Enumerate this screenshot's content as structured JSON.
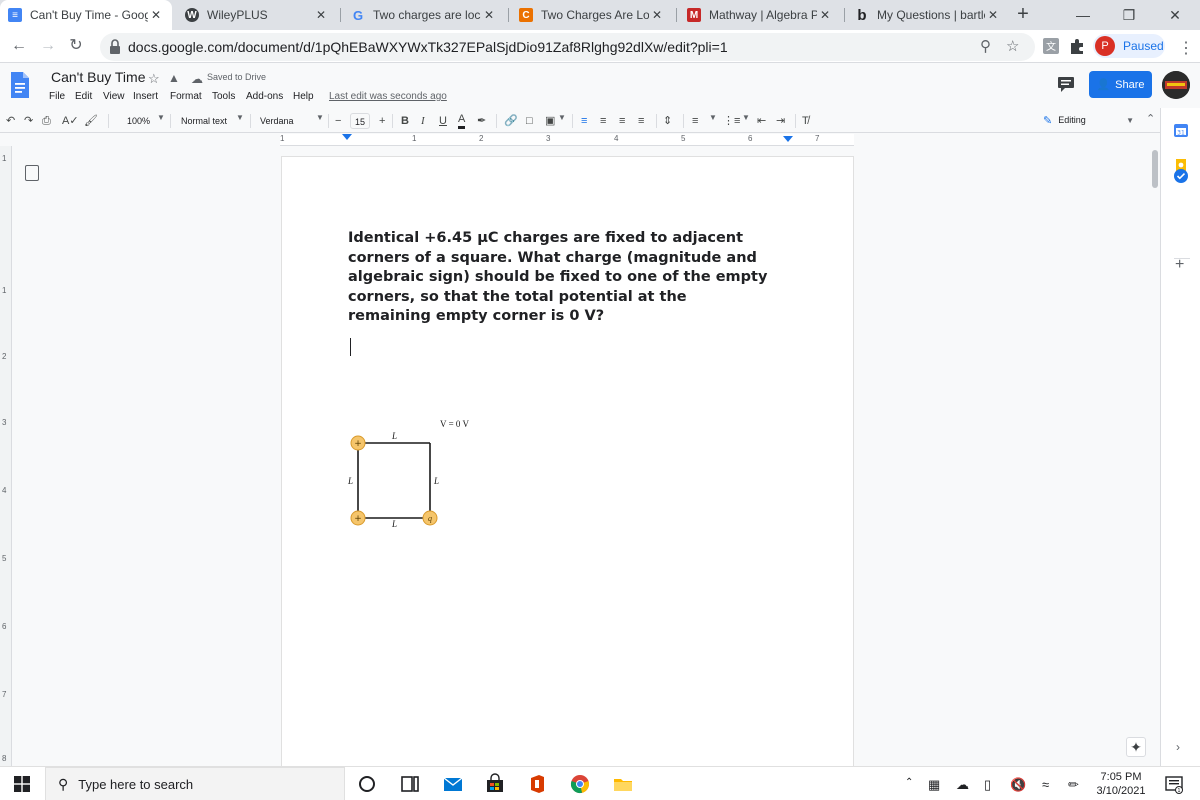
{
  "browser": {
    "tabs": [
      {
        "title": "Can't Buy Time - Googl",
        "active": true
      },
      {
        "title": "WileyPLUS",
        "active": false
      },
      {
        "title": "Two charges are locate",
        "active": false
      },
      {
        "title": "Two Charges Are Locate",
        "active": false
      },
      {
        "title": "Mathway | Algebra Prol",
        "active": false
      },
      {
        "title": "My Questions | bartleby",
        "active": false
      }
    ],
    "url": "docs.google.com/document/d/1pQhEBaWXYWxTk327EPalSjdDio91Zaf8Rlghg92dlXw/edit?pli=1",
    "profile_initial": "P",
    "profile_status": "Paused"
  },
  "docs": {
    "title": "Can't Buy Time",
    "save_status": "Saved to Drive",
    "menus": [
      "File",
      "Edit",
      "View",
      "Insert",
      "Format",
      "Tools",
      "Add-ons",
      "Help"
    ],
    "last_edit": "Last edit was seconds ago",
    "share_label": "Share",
    "toolbar": {
      "zoom": "100%",
      "style": "Normal text",
      "font": "Verdana",
      "font_size": "15",
      "mode": "Editing"
    },
    "ruler_numbers": [
      "1",
      "1",
      "2",
      "3",
      "4",
      "5",
      "6",
      "7"
    ],
    "vruler_numbers": [
      "1",
      "1",
      "2",
      "3",
      "4",
      "5",
      "6",
      "7",
      "8"
    ],
    "question": "Identical +6.45 μC charges are fixed to adjacent corners of a square. What charge (magnitude and algebraic sign) should be fixed to one of the empty corners, so that the total potential at the remaining empty corner is 0 V?",
    "diagram": {
      "potential_label": "V = 0 V",
      "side_label": "L",
      "charge_plus": "+",
      "charge_q": "q"
    }
  },
  "taskbar": {
    "search_placeholder": "Type here to search",
    "time": "7:05 PM",
    "date": "3/10/2021"
  },
  "colors": {
    "accent": "#1a73e8",
    "charge_fill": "#f5c56b",
    "charge_stroke": "#d99a2b"
  }
}
